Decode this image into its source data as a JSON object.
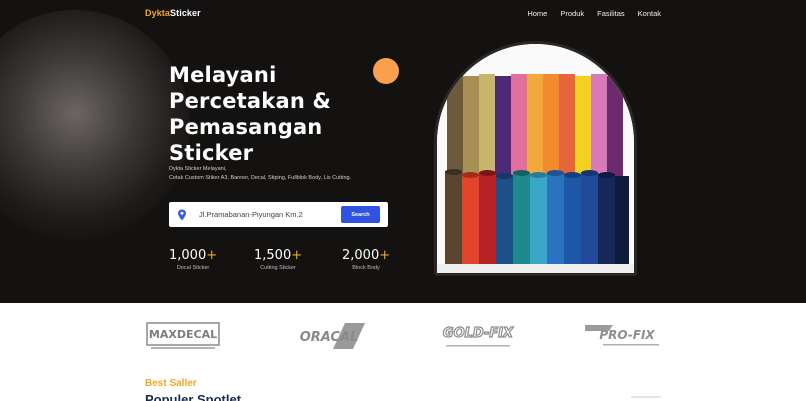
{
  "brand": {
    "part1": "Dykta",
    "part2": "Sticker"
  },
  "nav": {
    "items": [
      "Home",
      "Produk",
      "Fasilitas",
      "Kontak"
    ]
  },
  "hero": {
    "title": "Melayani Percetakan & Pemasangan Sticker",
    "description_line1": "Dykta Sticker Melayani,",
    "description_line2": "Cetak Custom Stiker A3, Banner, Decal, Stiping, Fullblok Body, Lis Cutting.",
    "accent_color": "#f5a623"
  },
  "search": {
    "value": "Jl.Pramabanan-Piyungan Km.2",
    "button_label": "Search",
    "icon": "location-pin-icon"
  },
  "stats": [
    {
      "value": "1,000",
      "suffix": "+",
      "label": "Decal Sticker"
    },
    {
      "value": "1,500",
      "suffix": "+",
      "label": "Cutting Sticker"
    },
    {
      "value": "2,000",
      "suffix": "+",
      "label": "Block Body"
    }
  ],
  "partners": [
    {
      "name": "MAXDECAL"
    },
    {
      "name": "ORACAL"
    },
    {
      "name": "GOLD-FIX"
    },
    {
      "name": "PRO-FIX"
    }
  ],
  "section": {
    "eyebrow": "Best Saller",
    "title": "Populer Spotlet"
  }
}
